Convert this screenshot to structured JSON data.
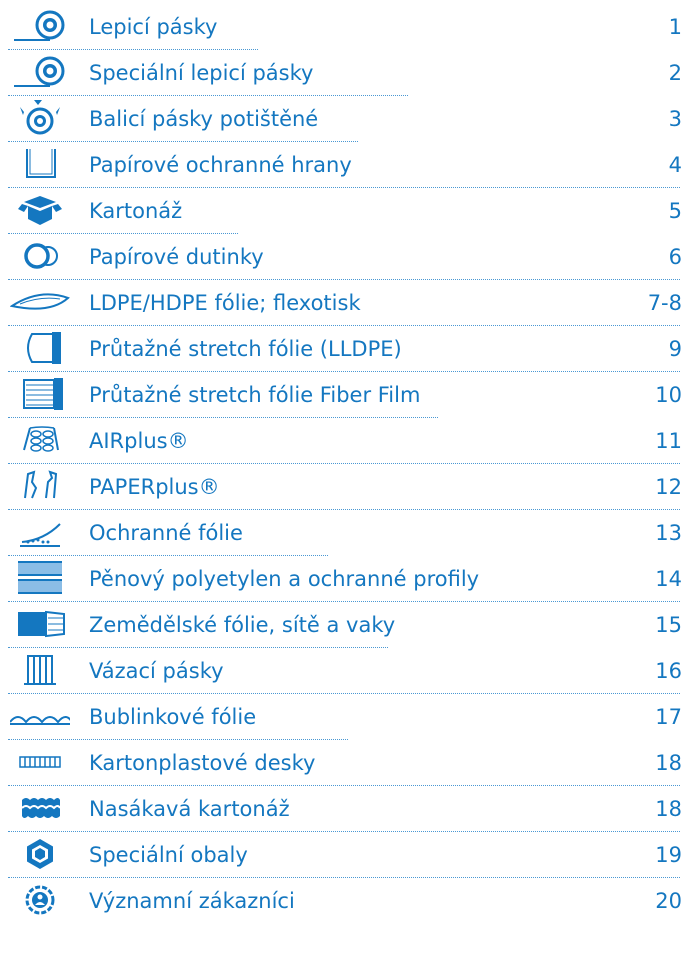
{
  "toc": {
    "items": [
      {
        "title": "Lepicí pásky",
        "page": "1",
        "icon": "tape-roll-icon"
      },
      {
        "title": "Speciální lepicí pásky",
        "page": "2",
        "icon": "special-tape-roll-icon"
      },
      {
        "title": "Balicí pásky potištěné",
        "page": "3",
        "icon": "printed-tape-icon"
      },
      {
        "title": "Papírové ochranné hrany",
        "page": "4",
        "icon": "edge-protector-icon"
      },
      {
        "title": "Kartonáž",
        "page": "5",
        "icon": "cardboard-box-icon"
      },
      {
        "title": "Papírové dutinky",
        "page": "6",
        "icon": "paper-core-icon"
      },
      {
        "title": "LDPE/HDPE fólie; flexotisk",
        "page": "7-8",
        "icon": "film-sheet-icon"
      },
      {
        "title": "Průtažné stretch fólie (LLDPE)",
        "page": "9",
        "icon": "stretch-film-icon"
      },
      {
        "title": "Průtažné stretch fólie Fiber Film",
        "page": "10",
        "icon": "fiber-film-icon"
      },
      {
        "title": "AIRplus®",
        "page": "11",
        "icon": "air-cushion-icon"
      },
      {
        "title": "PAPERplus®",
        "page": "12",
        "icon": "paper-fill-icon"
      },
      {
        "title": "Ochranné fólie",
        "page": "13",
        "icon": "protective-film-icon"
      },
      {
        "title": "Pěnový polyetylen a ochranné profily",
        "page": "14",
        "icon": "foam-icon"
      },
      {
        "title": "Zemědělské fólie, sítě a vaky",
        "page": "15",
        "icon": "agri-film-icon"
      },
      {
        "title": "Vázací pásky",
        "page": "16",
        "icon": "strapping-icon"
      },
      {
        "title": "Bublinkové fólie",
        "page": "17",
        "icon": "bubble-wrap-icon"
      },
      {
        "title": "Kartonplastové desky",
        "page": "18",
        "icon": "corrugated-plastic-icon"
      },
      {
        "title": "Nasákavá kartonáž",
        "page": "18",
        "icon": "absorbent-cardboard-icon"
      },
      {
        "title": "Speciální obaly",
        "page": "19",
        "icon": "special-packaging-icon"
      },
      {
        "title": "Významní zákazníci",
        "page": "20",
        "icon": "customers-icon"
      }
    ]
  },
  "colors": {
    "accent": "#1477c0",
    "dots": "#4a98d3"
  }
}
